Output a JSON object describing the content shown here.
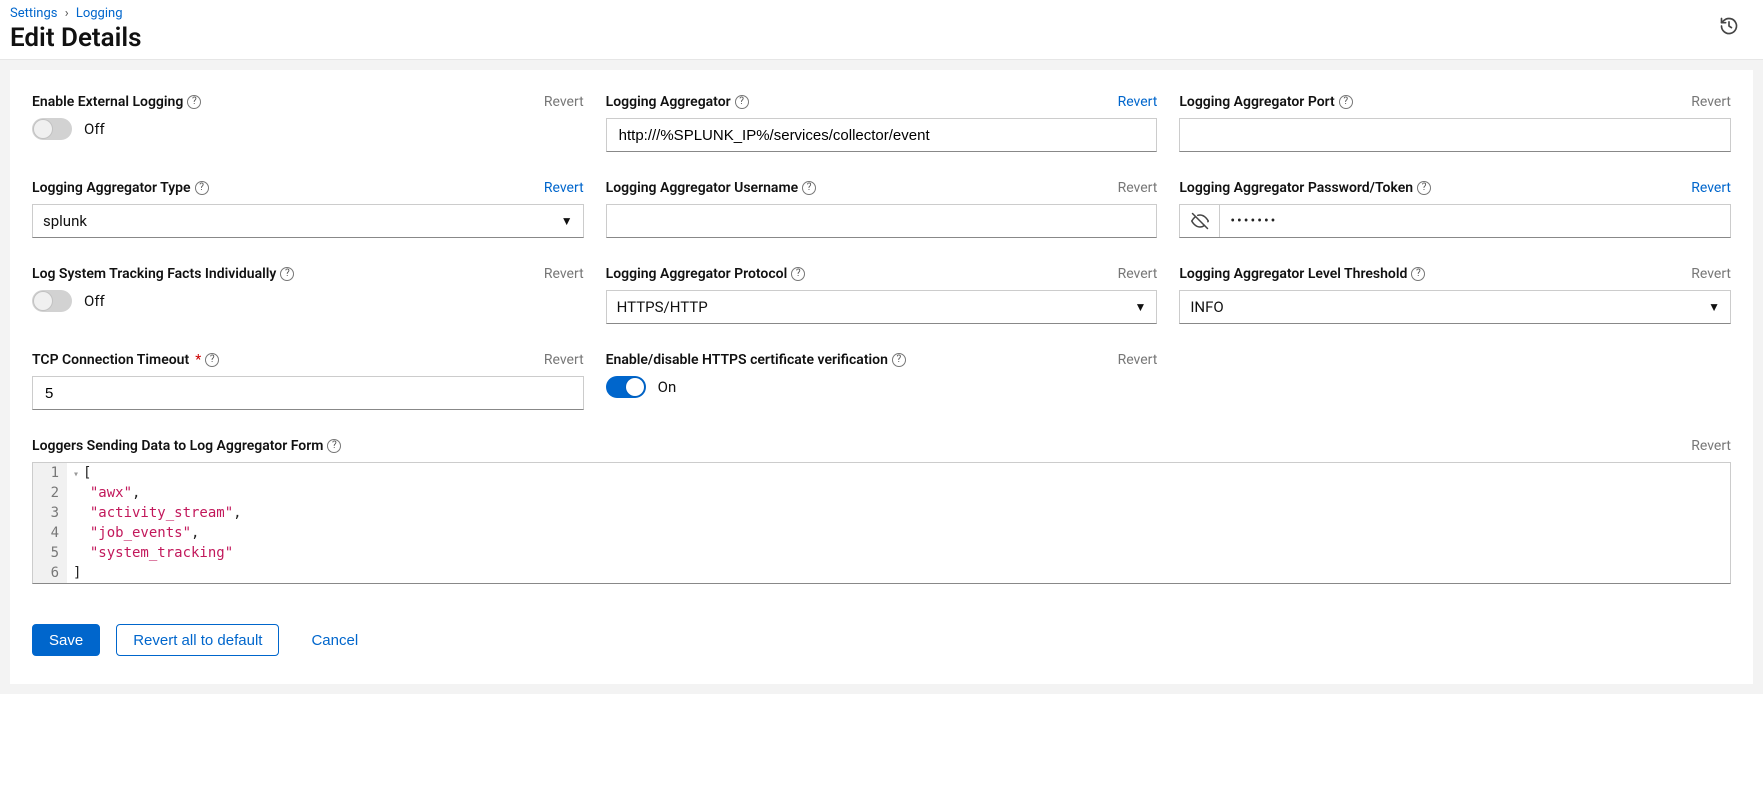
{
  "breadcrumb": {
    "settings": "Settings",
    "logging": "Logging"
  },
  "page_title": "Edit Details",
  "revert_text": "Revert",
  "toggle_off": "Off",
  "toggle_on": "On",
  "f_ext_log": {
    "label": "Enable External Logging",
    "state": "off",
    "revert_active": false
  },
  "f_aggr": {
    "label": "Logging Aggregator",
    "value": "http:///%SPLUNK_IP%/services/collector/event",
    "revert_active": true
  },
  "f_port": {
    "label": "Logging Aggregator Port",
    "value": "",
    "revert_active": false
  },
  "f_type": {
    "label": "Logging Aggregator Type",
    "value": "splunk",
    "revert_active": true
  },
  "f_user": {
    "label": "Logging Aggregator Username",
    "value": "",
    "revert_active": false
  },
  "f_pw": {
    "label": "Logging Aggregator Password/Token",
    "value": "•••••••",
    "revert_active": true
  },
  "f_track": {
    "label": "Log System Tracking Facts Individually",
    "state": "off",
    "revert_active": false
  },
  "f_proto": {
    "label": "Logging Aggregator Protocol",
    "value": "HTTPS/HTTP",
    "revert_active": false
  },
  "f_level": {
    "label": "Logging Aggregator Level Threshold",
    "value": "INFO",
    "revert_active": false
  },
  "f_tcp": {
    "label": "TCP Connection Timeout",
    "value": "5",
    "required": true,
    "revert_active": false
  },
  "f_https": {
    "label": "Enable/disable HTTPS certificate verification",
    "state": "on",
    "revert_active": false
  },
  "f_loggers": {
    "label": "Loggers Sending Data to Log Aggregator Form",
    "revert_active": false,
    "lines": [
      {
        "n": "1",
        "fold": true,
        "tokens": [
          {
            "t": "[",
            "c": "punc"
          }
        ]
      },
      {
        "n": "2",
        "fold": false,
        "tokens": [
          {
            "t": "  ",
            "c": "punc"
          },
          {
            "t": "\"awx\"",
            "c": "str"
          },
          {
            "t": ",",
            "c": "punc"
          }
        ]
      },
      {
        "n": "3",
        "fold": false,
        "tokens": [
          {
            "t": "  ",
            "c": "punc"
          },
          {
            "t": "\"activity_stream\"",
            "c": "str"
          },
          {
            "t": ",",
            "c": "punc"
          }
        ]
      },
      {
        "n": "4",
        "fold": false,
        "tokens": [
          {
            "t": "  ",
            "c": "punc"
          },
          {
            "t": "\"job_events\"",
            "c": "str"
          },
          {
            "t": ",",
            "c": "punc"
          }
        ]
      },
      {
        "n": "5",
        "fold": false,
        "tokens": [
          {
            "t": "  ",
            "c": "punc"
          },
          {
            "t": "\"system_tracking\"",
            "c": "str"
          }
        ]
      },
      {
        "n": "6",
        "fold": false,
        "tokens": [
          {
            "t": "]",
            "c": "punc"
          }
        ]
      }
    ]
  },
  "actions": {
    "save": "Save",
    "revert_all": "Revert all to default",
    "cancel": "Cancel"
  }
}
